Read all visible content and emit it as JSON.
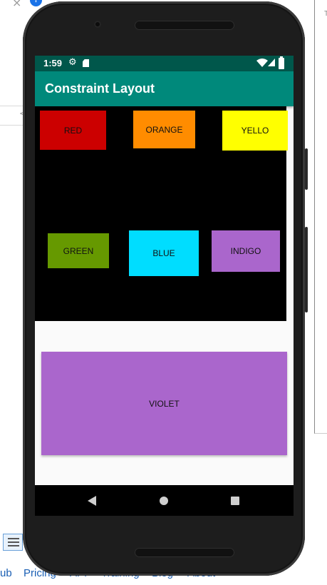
{
  "background": {
    "footer_links": [
      "ub",
      "Pricing",
      "API",
      "Training",
      "Blog",
      "About"
    ],
    "right_panel_char": "T"
  },
  "status_bar": {
    "time": "1:59",
    "icons": [
      "gear-icon",
      "sd-card-icon",
      "wifi-icon",
      "signal-icon",
      "battery-icon"
    ],
    "color": "#00574b"
  },
  "app_bar": {
    "title": "Constraint Layout",
    "color": "#00897b"
  },
  "boxes": {
    "red": {
      "label": "RED",
      "color": "#cc0000"
    },
    "orange": {
      "label": "ORANGE",
      "color": "#ff8c00"
    },
    "yellow": {
      "label": "YELLO",
      "color": "#ffff00"
    },
    "green": {
      "label": "GREEN",
      "color": "#669900"
    },
    "blue": {
      "label": "BLUE",
      "color": "#00ddff"
    },
    "indigo": {
      "label": "INDIGO",
      "color": "#aa66cc"
    },
    "violet": {
      "label": "VIOLET",
      "color": "#aa66cc"
    }
  },
  "nav_bar": {
    "buttons": [
      "back-icon",
      "home-icon",
      "recents-icon"
    ]
  }
}
